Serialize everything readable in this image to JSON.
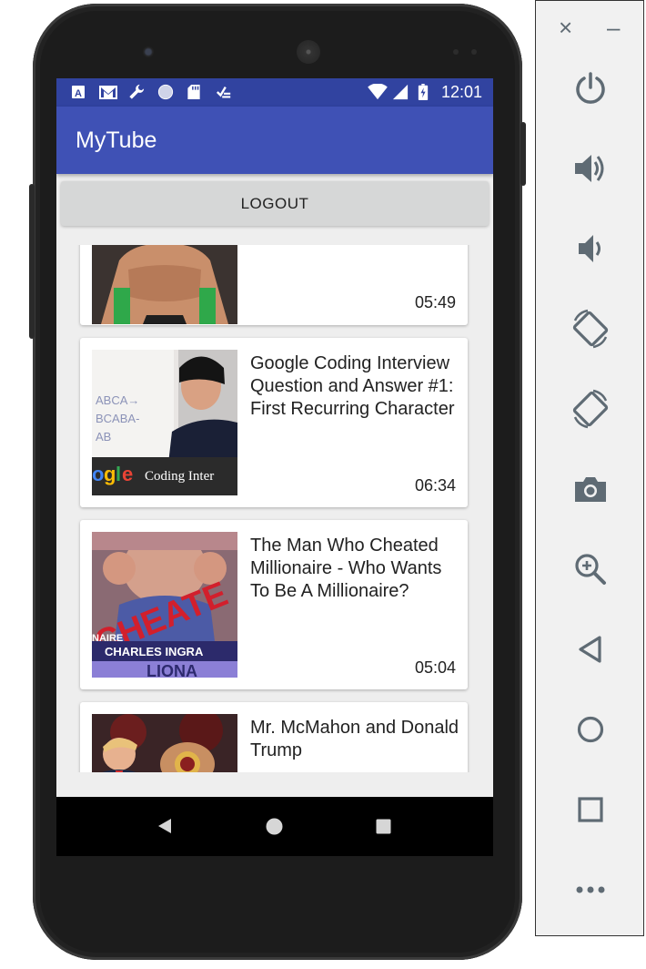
{
  "app": {
    "title": "MyTube"
  },
  "status_bar": {
    "time": "12:01",
    "left_icons": [
      "accessibility-a-icon",
      "gmail-icon",
      "wrench-icon",
      "circle-icon",
      "sd-card-icon",
      "task-check-icon"
    ],
    "right_icons": [
      "wifi-icon",
      "signal-icon",
      "battery-icon"
    ]
  },
  "logout": {
    "label": "LOGOUT"
  },
  "videos": [
    {
      "title": "",
      "duration": "05:49",
      "thumb": "wrestler-thumbnail"
    },
    {
      "title": "Google Coding Interview Question and Answer #1: First Recurring Character",
      "duration": "06:34",
      "thumb": "google-coding-thumbnail",
      "thumb_caption": "Coding Inter"
    },
    {
      "title": "The Man Who Cheated Millionaire - Who Wants To Be A Millionaire?",
      "duration": "05:04",
      "thumb": "cheated-thumbnail",
      "thumb_caption": "CHARLES INGRA",
      "thumb_overlay": "CHEATE",
      "thumb_small": "NAIRE",
      "thumb_bottom": "LIONA"
    },
    {
      "title": "Mr. McMahon and Donald Trump",
      "duration": "",
      "thumb": "mcmahon-trump-thumbnail"
    }
  ],
  "nav": {
    "buttons": [
      "back-icon",
      "home-icon",
      "recents-icon"
    ]
  },
  "emulator_panel": {
    "controls": [
      "close-icon",
      "minimize-icon",
      "power-icon",
      "volume-up-icon",
      "volume-down-icon",
      "rotate-left-icon",
      "rotate-right-icon",
      "camera-icon",
      "zoom-icon",
      "back-icon",
      "home-icon",
      "overview-icon",
      "more-icon"
    ]
  },
  "colors": {
    "primary": "#3f51b5",
    "primary_dark": "#3143a0",
    "icon_gray": "#5f6b74"
  }
}
